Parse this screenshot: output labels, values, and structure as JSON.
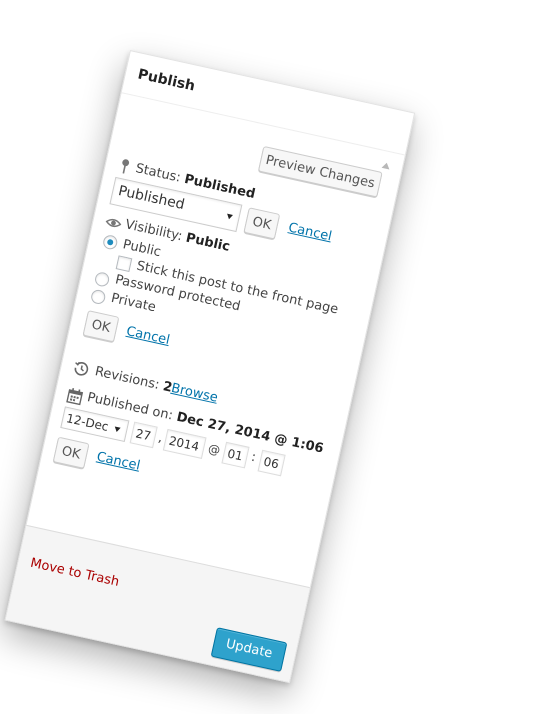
{
  "panel": {
    "title": "Publish",
    "preview_button": "Preview Changes"
  },
  "status": {
    "label": "Status:",
    "value": "Published",
    "select_value": "Published",
    "ok": "OK",
    "cancel": "Cancel"
  },
  "visibility": {
    "label": "Visibility:",
    "value": "Public",
    "options": {
      "public": "Public",
      "sticky": "Stick this post to the front page",
      "password": "Password protected",
      "private": "Private"
    },
    "ok": "OK",
    "cancel": "Cancel"
  },
  "revisions": {
    "label": "Revisions:",
    "count": "2",
    "browse": "Browse"
  },
  "published_on": {
    "label": "Published on:",
    "value": "Dec 27, 2014 @ 1:06",
    "month": "12-Dec",
    "day": "27",
    "comma": ",",
    "year": "2014",
    "at": "@",
    "hour": "01",
    "colon": ":",
    "minute": "06",
    "ok": "OK",
    "cancel": "Cancel"
  },
  "footer": {
    "trash": "Move to Trash",
    "update": "Update"
  },
  "colors": {
    "link": "#0073aa",
    "trash": "#aa0000",
    "primary": "#2ea2cc"
  },
  "icons": {
    "status": "pin-icon",
    "visibility": "eye-icon",
    "revisions": "history-icon",
    "published_on": "calendar-icon",
    "collapse": "triangle-up-icon"
  }
}
